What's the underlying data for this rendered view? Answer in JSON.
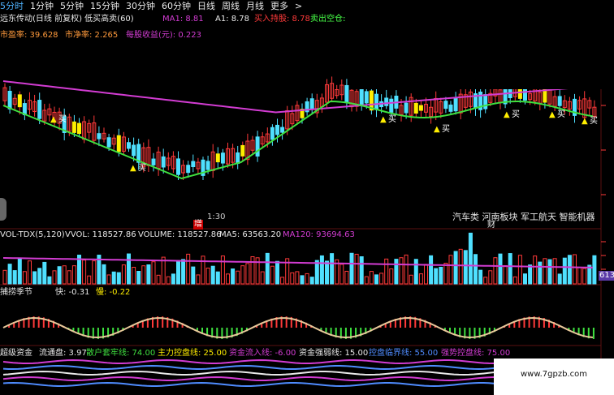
{
  "topbar": {
    "items": [
      "5分时",
      "1分钟",
      "5分钟",
      "15分钟",
      "30分钟",
      "60分钟",
      "日线",
      "周线",
      "月线",
      "更多",
      ">"
    ],
    "active_index": 0
  },
  "header1": {
    "stock": "远东传动(日线 前复权)",
    "indicator": "低买高卖(60)",
    "ma1": "MA1: 8.81",
    "a1": "A1: 8.78",
    "buy_hold": "买入持股: 8.78",
    "sell_empty": "卖出空仓:"
  },
  "header2": {
    "pe": "市盈率: 39.628",
    "pb": "市净率: 2.265",
    "eps": "每股收益(元): 0.223"
  },
  "price_panel": {
    "buy_label": "买",
    "tags": [
      "汽车类",
      "河南板块",
      "军工航天",
      "智能机器"
    ],
    "tag_sub": "财",
    "left_time": "1:30",
    "zeng": "增"
  },
  "volume_panel": {
    "label": "VOL-TDX(5,120)",
    "vvol": "VVOL: 118527.86",
    "volume": "VOLUME: 118527.86",
    "ma5": "MA5: 63563.20",
    "ma120": "MA120: 93694.63",
    "right_value": "613"
  },
  "osc_panel": {
    "label": "捕捞季节",
    "fast": "快: -0.31",
    "slow": "慢: -0.22"
  },
  "bottom_panel": {
    "label": "超级资金",
    "circ": "流通盘: 3.97",
    "retail": "散户套牢线: 74.00",
    "control": "主力控盘线: 25.00",
    "inflow": "资金流入线: -6.00",
    "strength": "资金强弱线: 15.00",
    "critical": "控盘临界线: 55.00",
    "strong": "强势控盘线: 75.00"
  },
  "watermark": "www.7gpzb.com",
  "colors": {
    "up": "#ff3a3a",
    "down": "#4fe0ff",
    "ma_magenta": "#d23cd2",
    "ma_green": "#3fe03f",
    "yellow": "#ffee00",
    "grid": "#5a1010"
  }
}
